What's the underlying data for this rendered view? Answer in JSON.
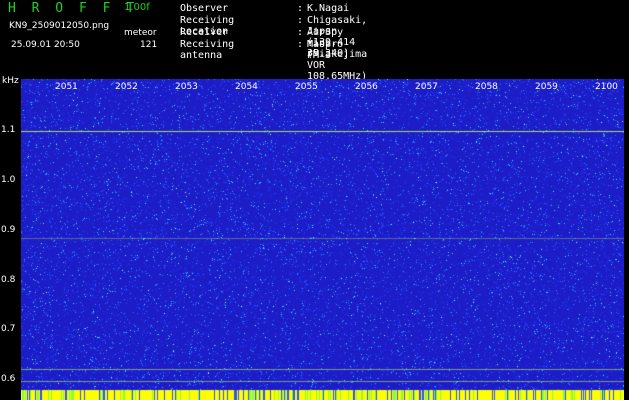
{
  "header": {
    "app_title": "H R O F F T",
    "version": "1.00f",
    "filename": "KN9_2509012050.png",
    "username": "meteor",
    "datetime": "25.09.01 20:50",
    "count": "121"
  },
  "info": [
    {
      "label": "Observer",
      "value": "K.Nagai"
    },
    {
      "label": "Receiving Location",
      "value": "Chigasaki, Japan (139.414 35.340)"
    },
    {
      "label": "Receiver",
      "value": "AirSpy mini (Miakejima VOR 108.65MHz)"
    },
    {
      "label": "Receiving antenna",
      "value": "Maspro FM-3"
    }
  ],
  "separator": ":",
  "spectrogram": {
    "y_unit": "kHz",
    "y_ticks": [
      "1.1",
      "1.0",
      "0.9",
      "0.8",
      "0.7",
      "0.6"
    ],
    "x_ticks": [
      "2051",
      "2052",
      "2053",
      "2054",
      "2055",
      "2056",
      "2057",
      "2058",
      "2059",
      "2100"
    ],
    "colors": {
      "background": "#1d1dc8",
      "noise_mid": "#2a8cff",
      "noise_high": "#3ff0ff",
      "carrier_line": "#c8ff3a",
      "yellow_strip": "#ffff00",
      "label_text": "#1fd21f"
    }
  }
}
